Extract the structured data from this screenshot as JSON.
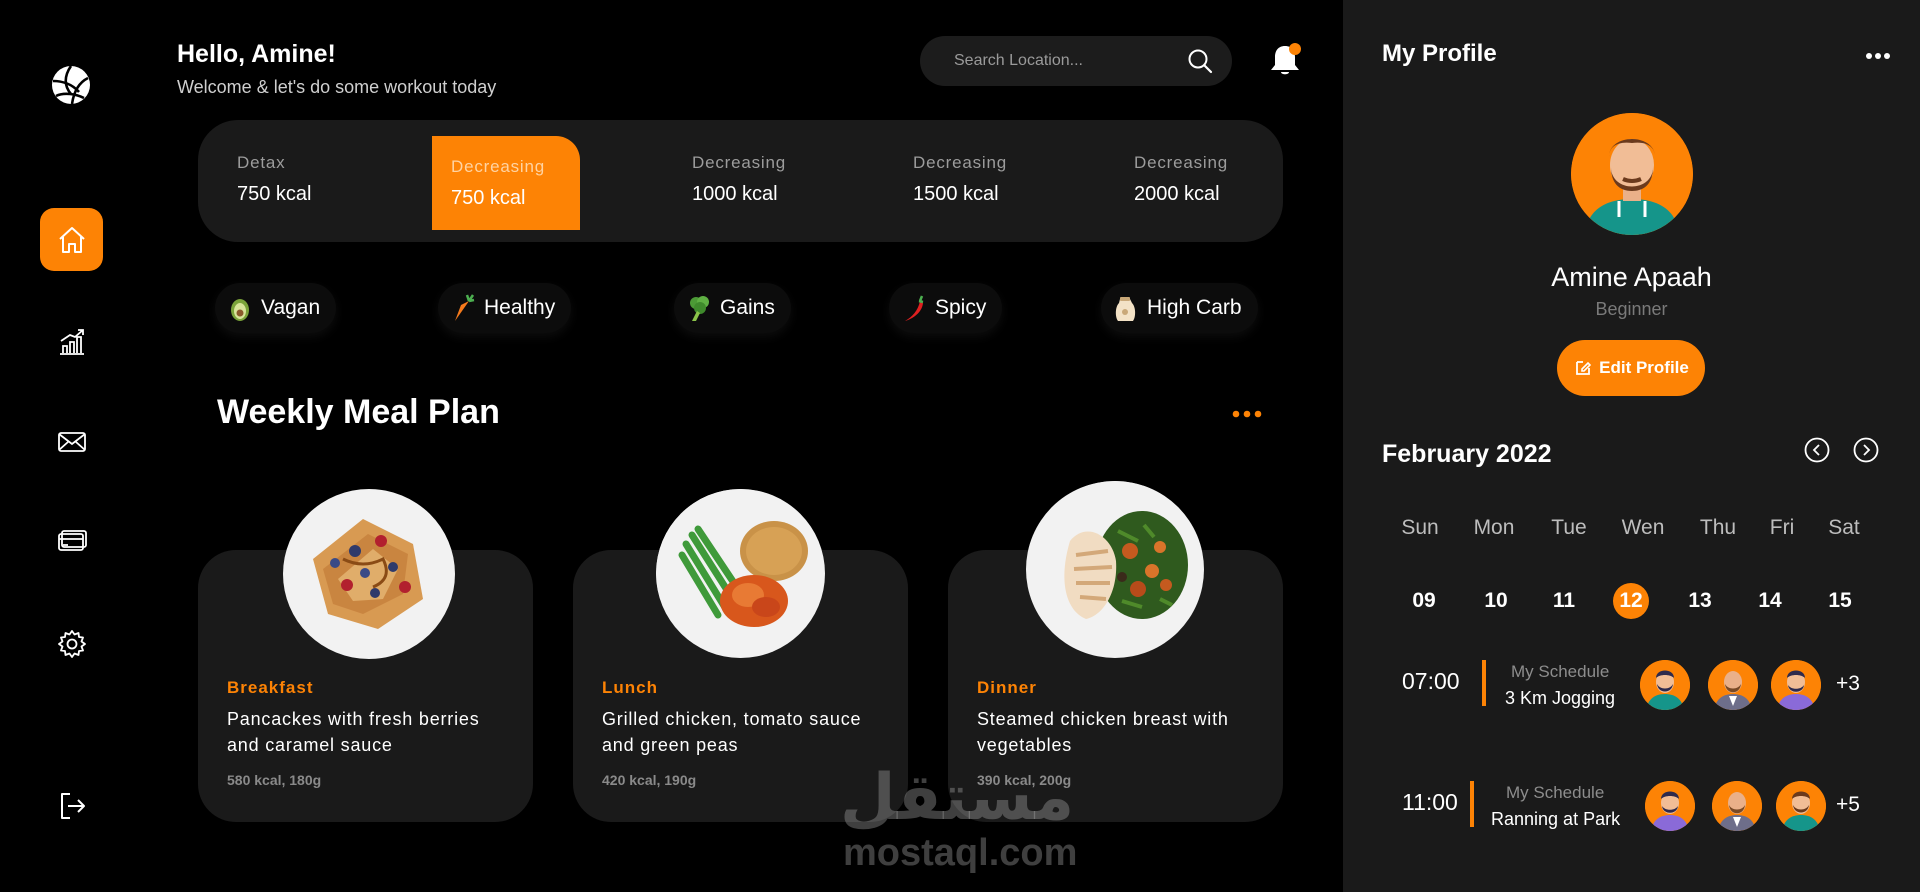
{
  "sidebar": {
    "logo": "volleyball-logo",
    "items": [
      {
        "icon": "home-icon",
        "active": true
      },
      {
        "icon": "chart-icon",
        "active": false
      },
      {
        "icon": "mail-icon",
        "active": false
      },
      {
        "icon": "credit-card-icon",
        "active": false
      },
      {
        "icon": "gear-icon",
        "active": false
      }
    ],
    "logout_icon": "logout-icon"
  },
  "header": {
    "greeting": "Hello, Amine!",
    "subtitle": "Welcome & let's do some workout today",
    "search_placeholder": "Search Location...",
    "notification_dot": true
  },
  "calories": [
    {
      "label": "Detax",
      "value": "750 kcal",
      "active": false
    },
    {
      "label": "Decreasing",
      "value": "750 kcal",
      "active": true
    },
    {
      "label": "Decreasing",
      "value": "1000 kcal",
      "active": false
    },
    {
      "label": "Decreasing",
      "value": "1500 kcal",
      "active": false
    },
    {
      "label": "Decreasing",
      "value": "2000 kcal",
      "active": false
    }
  ],
  "categories": [
    {
      "label": "Vagan",
      "icon": "avocado-icon"
    },
    {
      "label": "Healthy",
      "icon": "carrot-icon"
    },
    {
      "label": "Gains",
      "icon": "broccoli-icon"
    },
    {
      "label": "Spicy",
      "icon": "chili-pepper-icon"
    },
    {
      "label": "High Carb",
      "icon": "flour-sack-icon"
    }
  ],
  "weekly": {
    "title": "Weekly Meal Plan",
    "meals": [
      {
        "type": "Breakfast",
        "name": "Pancackes with fresh berries and caramel sauce",
        "info": "580 kcal, 180g"
      },
      {
        "type": "Lunch",
        "name": "Grilled chicken, tomato sauce and green peas",
        "info": "420 kcal, 190g"
      },
      {
        "type": "Dinner",
        "name": "Steamed chicken breast with vegetables",
        "info": "390 kcal, 200g"
      }
    ]
  },
  "watermark": {
    "arabic": "مستقل",
    "latin": "mostaql.com"
  },
  "profile": {
    "title": "My Profile",
    "name": "Amine Apaah",
    "level": "Beginner",
    "edit_label": "Edit Profile"
  },
  "calendar": {
    "month": "February 2022",
    "weekdays": [
      "Sun",
      "Mon",
      "Tue",
      "Wen",
      "Thu",
      "Fri",
      "Sat"
    ],
    "days": [
      "09",
      "10",
      "11",
      "12",
      "13",
      "14",
      "15"
    ],
    "selected": "12"
  },
  "schedule": [
    {
      "time": "07:00",
      "label": "My Schedule",
      "activity": "3 Km Jogging",
      "extra": "+3"
    },
    {
      "time": "11:00",
      "label": "My Schedule",
      "activity": "Ranning at Park",
      "extra": "+5"
    }
  ],
  "colors": {
    "accent": "#fd8305",
    "card": "#1a1a1a",
    "background": "#000000"
  }
}
